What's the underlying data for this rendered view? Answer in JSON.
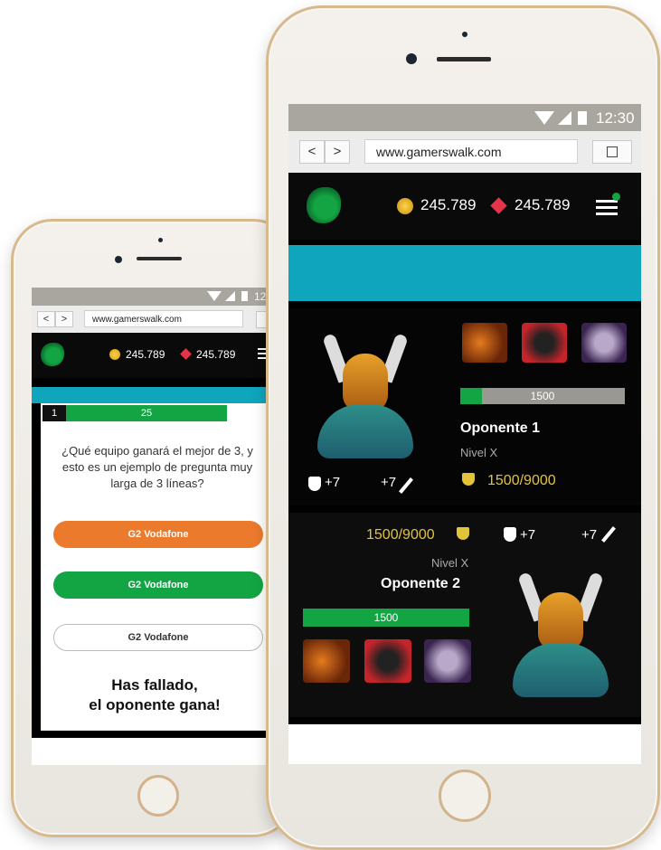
{
  "right_phone": {
    "status": {
      "time": "12:30"
    },
    "browser": {
      "url": "www.gamerswalk.com",
      "back": "<",
      "forward": ">"
    },
    "header": {
      "coins": "245.789",
      "gems": "245.789",
      "badge": ""
    },
    "opponent1": {
      "name": "Oponente 1",
      "level": "Nivel X",
      "bar_value": "1500",
      "bar_fraction": 0.13,
      "score": "1500/9000",
      "defense": "+7",
      "attack": "+7"
    },
    "opponent2": {
      "name": "Oponente  2",
      "level": "Nivel X",
      "bar_value": "1500",
      "bar_fraction": 1.0,
      "score": "1500/9000",
      "defense": "+7",
      "attack": "+7"
    }
  },
  "left_phone": {
    "status": {
      "time": "12"
    },
    "browser": {
      "url": "www.gamerswalk.com",
      "back": "<",
      "forward": ">"
    },
    "header": {
      "coins": "245.789",
      "gems": "245.789"
    },
    "quiz": {
      "question_number": "1",
      "timer": "25",
      "question": "¿Qué equipo ganará el mejor de 3, y esto es un ejemplo de pregunta muy larga de 3 líneas?",
      "answers": [
        "G2 Vodafone",
        "G2 Vodafone",
        "G2 Vodafone"
      ],
      "result_line1": "Has fallado,",
      "result_line2": "el oponente gana!"
    }
  },
  "colors": {
    "teal": "#0fa5bd",
    "green": "#13a543",
    "orange": "#ec7a2c",
    "gold": "#e2c43b"
  }
}
